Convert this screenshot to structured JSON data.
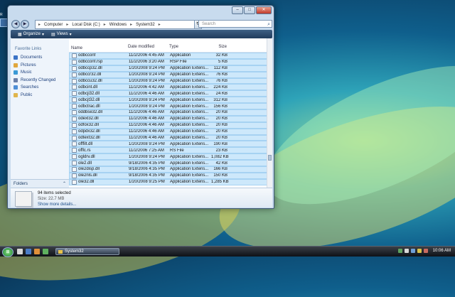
{
  "desktop": {
    "icon_label": "R"
  },
  "window": {
    "buttons": {
      "minimize": "–",
      "maximize": "□",
      "close": "✕"
    },
    "nav": {
      "back": "◀",
      "forward": "▶",
      "refresh": "↻"
    },
    "breadcrumb": [
      "Computer",
      "Local Disk (C:)",
      "Windows",
      "System32"
    ],
    "search_placeholder": "Search",
    "toolbar": {
      "organize": "Organize",
      "views": "Views"
    }
  },
  "left_pane": {
    "title": "Favorite Links",
    "items": [
      "Documents",
      "Pictures",
      "Music",
      "Recently Changed",
      "Searches",
      "Public"
    ],
    "folders_label": "Folders"
  },
  "file_list": {
    "columns": [
      "Name",
      "Date modified",
      "Type",
      "Size"
    ],
    "rows": [
      {
        "name": "odbcconf",
        "date": "11/2/2006 4:45 AM",
        "type": "Application",
        "size": "32 KB"
      },
      {
        "name": "odbcconf.rsp",
        "date": "11/2/2006 3:20 AM",
        "type": "RSP File",
        "size": "5 KB"
      },
      {
        "name": "odbccp32.dll",
        "date": "1/20/2008 9:24 PM",
        "type": "Application Extens...",
        "size": "112 KB"
      },
      {
        "name": "odbccr32.dll",
        "date": "1/20/2008 9:24 PM",
        "type": "Application Extens...",
        "size": "76 KB"
      },
      {
        "name": "odbccu32.dll",
        "date": "1/20/2008 9:24 PM",
        "type": "Application Extens...",
        "size": "76 KB"
      },
      {
        "name": "odbcint.dll",
        "date": "11/2/2006 4:42 AM",
        "type": "Application Extens...",
        "size": "224 KB"
      },
      {
        "name": "odbcji32.dll",
        "date": "11/2/2006 4:46 AM",
        "type": "Application Extens...",
        "size": "24 KB"
      },
      {
        "name": "odbcjt32.dll",
        "date": "1/20/2008 9:24 PM",
        "type": "Application Extens...",
        "size": "312 KB"
      },
      {
        "name": "odbctrac.dll",
        "date": "1/20/2008 9:24 PM",
        "type": "Application Extens...",
        "size": "156 KB"
      },
      {
        "name": "oddbse32.dll",
        "date": "11/2/2006 4:46 AM",
        "type": "Application Extens...",
        "size": "20 KB"
      },
      {
        "name": "odexl32.dll",
        "date": "11/2/2006 4:46 AM",
        "type": "Application Extens...",
        "size": "20 KB"
      },
      {
        "name": "odfox32.dll",
        "date": "11/2/2006 4:46 AM",
        "type": "Application Extens...",
        "size": "20 KB"
      },
      {
        "name": "odpdx32.dll",
        "date": "11/2/2006 4:46 AM",
        "type": "Application Extens...",
        "size": "20 KB"
      },
      {
        "name": "odtext32.dll",
        "date": "11/2/2006 4:46 AM",
        "type": "Application Extens...",
        "size": "20 KB"
      },
      {
        "name": "offfilt.dll",
        "date": "1/20/2008 9:24 PM",
        "type": "Application Extens...",
        "size": "190 KB"
      },
      {
        "name": "offlc.rs",
        "date": "11/2/2006 7:25 AM",
        "type": "RS File",
        "size": "23 KB"
      },
      {
        "name": "ogldrv.dll",
        "date": "1/20/2008 9:24 PM",
        "type": "Application Extens...",
        "size": "1,082 KB"
      },
      {
        "name": "ole2.dll",
        "date": "9/18/2006 4:35 PM",
        "type": "Application Extens...",
        "size": "42 KB"
      },
      {
        "name": "ole2disp.dll",
        "date": "9/18/2006 4:35 PM",
        "type": "Application Extens...",
        "size": "166 KB"
      },
      {
        "name": "ole2nls.dll",
        "date": "9/18/2006 4:35 PM",
        "type": "Application Extens...",
        "size": "150 KB"
      },
      {
        "name": "ole32.dll",
        "date": "1/20/2008 9:25 PM",
        "type": "Application Extens...",
        "size": "1,285 KB"
      }
    ]
  },
  "details": {
    "title": "94 items selected",
    "size_label": "Size: 22.7 MB",
    "more": "Show more details..."
  },
  "taskbar": {
    "start_glyph": "⊞",
    "task_label": "System32",
    "clock": "10:06 AM"
  },
  "colors": {
    "favorites": [
      "#3b73c6",
      "#e0a63c",
      "#3b9ad6",
      "#6a7fa8",
      "#4f8fd6",
      "#e0b54c"
    ],
    "quick_launch": [
      "#d9d9d9",
      "#4a7cc7",
      "#e0903a",
      "#5fb05f"
    ],
    "tray": [
      "#5fa35f",
      "#d9d9d9",
      "#6fa0d8",
      "#d9c24a",
      "#c96a5f"
    ]
  }
}
